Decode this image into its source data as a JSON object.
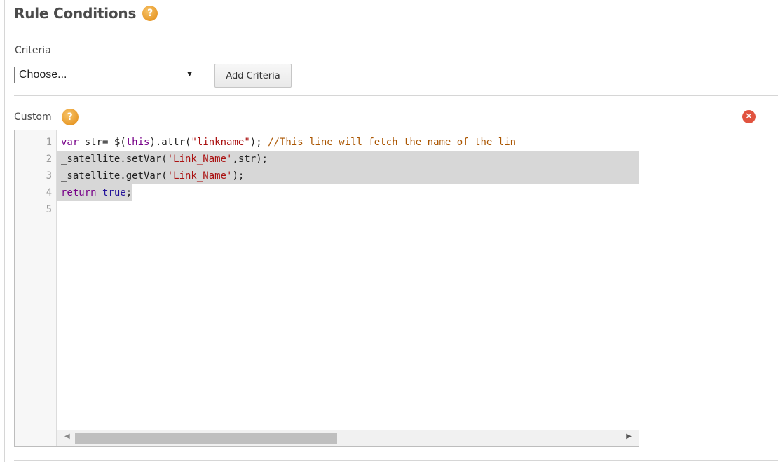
{
  "header": {
    "title": "Rule Conditions",
    "help": "?"
  },
  "criteria": {
    "label": "Criteria",
    "select_value": "Choose...",
    "select_arrow": "▼",
    "add_button": "Add Criteria"
  },
  "custom": {
    "label": "Custom",
    "help": "?",
    "close": "✕"
  },
  "editor": {
    "line_numbers": [
      "1",
      "2",
      "3",
      "4",
      "5"
    ],
    "lines": [
      "var str= $(this).attr(\"linkname\"); //This line will fetch the name of the lin",
      "_satellite.setVar('Link_Name',str);",
      "_satellite.getVar('Link_Name');",
      "return true;",
      ""
    ],
    "tokens": {
      "l1_var": "var",
      "l1_a": " str= $(",
      "l1_this": "this",
      "l1_b": ").attr(",
      "l1_str": "\"linkname\"",
      "l1_c": "); ",
      "l1_cmt": "//This line will fetch the name of the lin",
      "l2_a": "_satellite.setVar(",
      "l2_str": "'Link_Name'",
      "l2_b": ",str);",
      "l3_a": "_satellite.getVar(",
      "l3_str": "'Link_Name'",
      "l3_b": ");",
      "l4_return": "return",
      "l4_sp": " ",
      "l4_true": "true",
      "l4_end": ";"
    },
    "scroll_left": "◀",
    "scroll_right": "▶"
  }
}
